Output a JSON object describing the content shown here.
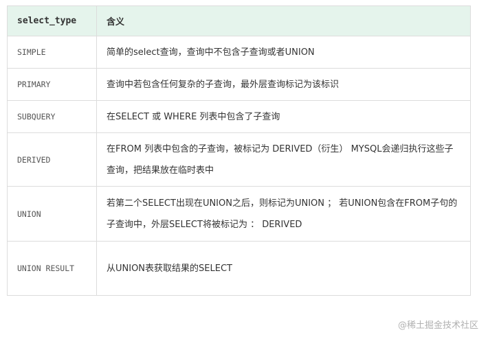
{
  "table": {
    "headers": [
      "select_type",
      "含义"
    ],
    "rows": [
      {
        "type": "SIMPLE",
        "desc": "简单的select查询，查询中不包含子查询或者UNION"
      },
      {
        "type": "PRIMARY",
        "desc": "查询中若包含任何复杂的子查询，最外层查询标记为该标识"
      },
      {
        "type": "SUBQUERY",
        "desc": "在SELECT 或 WHERE 列表中包含了子查询"
      },
      {
        "type": "DERIVED",
        "desc": "在FROM 列表中包含的子查询，被标记为 DERIVED（衍生） MYSQL会递归执行这些子查询，把结果放在临时表中"
      },
      {
        "type": "UNION",
        "desc": "若第二个SELECT出现在UNION之后，则标记为UNION ； 若UNION包含在FROM子句的子查询中，外层SELECT将被标记为 ： DERIVED"
      },
      {
        "type": "UNION RESULT",
        "desc": "从UNION表获取结果的SELECT"
      }
    ]
  },
  "watermark": "@稀土掘金技术社区"
}
